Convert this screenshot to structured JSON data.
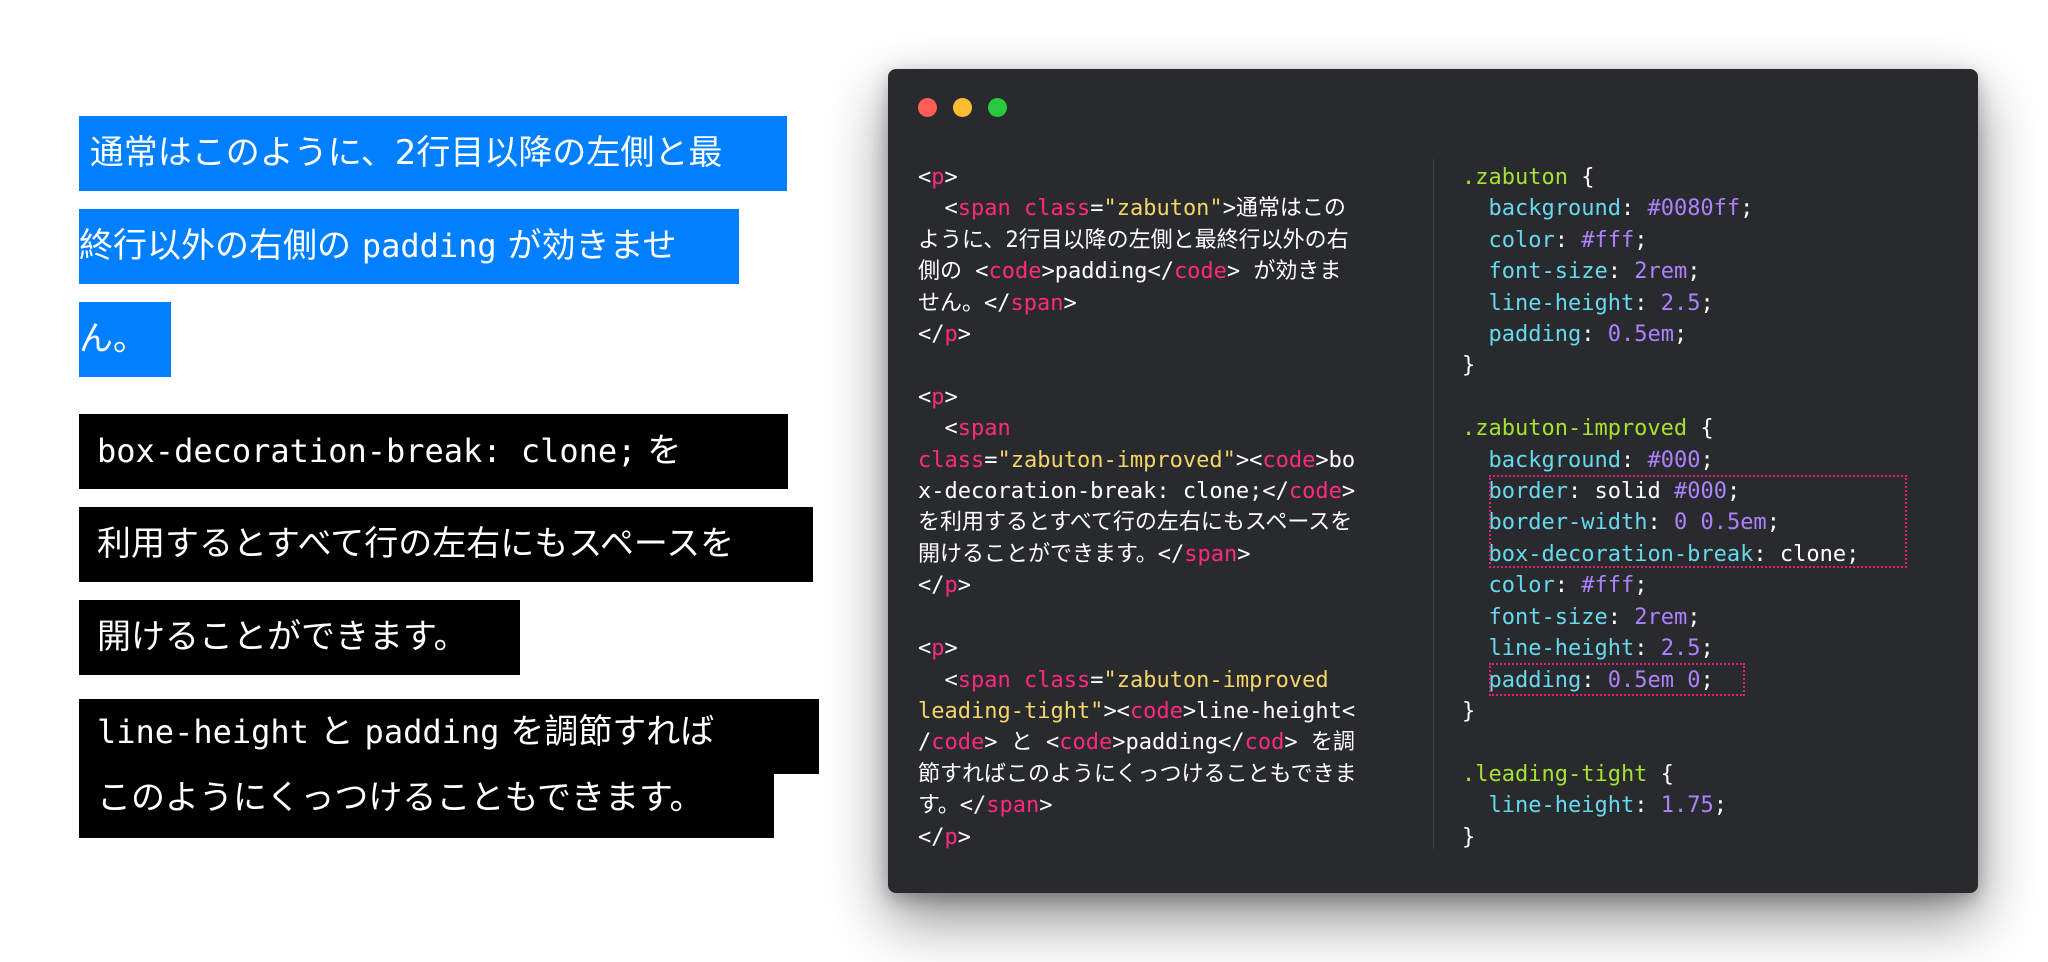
{
  "demo": {
    "p1": {
      "line1": " 通常はこのように、2行目以降の左側と最",
      "line2_text": "終行以外の右側の ",
      "line2_code": "padding",
      "line2_rest": " が効きませ",
      "line3": "ん。"
    },
    "p2": {
      "line1_code": "box-decoration-break: clone;",
      "line1_rest": " を",
      "line2": "利用するとすべて行の左右にもスペースを",
      "line3": "開けることができます。"
    },
    "p3": {
      "line1_code1": "line-height",
      "line1_mid": " と ",
      "line1_code2": "padding",
      "line1_rest": " を調節すれば",
      "line2": "このようにくっつけることもできます。"
    }
  },
  "window": {
    "controls": [
      "close",
      "minimize",
      "zoom"
    ],
    "html_code": {
      "a1": "<",
      "p_tag": "p",
      "a2": ">",
      "span_tag": "span",
      "class_attr": "class",
      "eq": "=",
      "zabuton_value": "\"zabuton\"",
      "line2_text": ">通常はこの",
      "line3": "ように、2行目以降の左側と最終行以外の右",
      "line4_pre": "側の <",
      "code_tag": "code",
      "line4_mid": ">padding</",
      "line4_post": "> が効きま",
      "line5_pre": "せん。</",
      "close_gt": ">",
      "close_p_open": "</",
      "line8_span": "<",
      "improved_value": "\"zabuton-improved\"",
      "line10_pre": "><",
      "line10_post": ">bo",
      "line11_pre": "x-decoration-break: clone;</",
      "line12": "を利用するとすべて行の左右にもスペースを",
      "line13_pre": "開けることができます。</",
      "tight_value1": "\"zabuton-improved",
      "tight_value2": "leading-tight\"",
      "line18_post": ">line-height<",
      "line19_pre": "/",
      "line19_mid": "> と <",
      "line19_mid2": ">padding</",
      "cod_tag": "cod",
      "line19_post": "> を調",
      "line20": "節すればこのようにくっつけることもできま",
      "line21_pre": "す。</"
    },
    "css_code": {
      "sel_zabuton": ".zabuton",
      "sel_improved": ".zabuton-improved",
      "sel_tight": ".leading-tight",
      "open_brace": " {",
      "close_brace": "}",
      "p_background": "background",
      "p_color": "color",
      "p_font_size": "font-size",
      "p_line_height": "line-height",
      "p_padding": "padding",
      "p_border": "border",
      "p_border_width": "border-width",
      "p_box_decoration": "box-decoration-break",
      "colon": ": ",
      "semi": ";",
      "v_0080ff": "#0080ff",
      "v_fff": "#fff",
      "v_2rem": "2rem",
      "v_2_5": "2.5",
      "v_05em": "0.5em",
      "v_000": "#000",
      "v_solid": "solid ",
      "v_0": "0",
      "v_05em_b": "0.5em",
      "v_clone": "clone",
      "v_05em_0": "0.5em 0",
      "v_1_75": "1.75"
    }
  },
  "colors": {
    "blue_bg": "#0080ff",
    "black_bg": "#000000",
    "window_bg": "#282a2e",
    "tag": "#ff2a7a",
    "string": "#f4d667",
    "selector": "#a6e22e",
    "property": "#66d9ef",
    "value": "#ae81ff"
  }
}
